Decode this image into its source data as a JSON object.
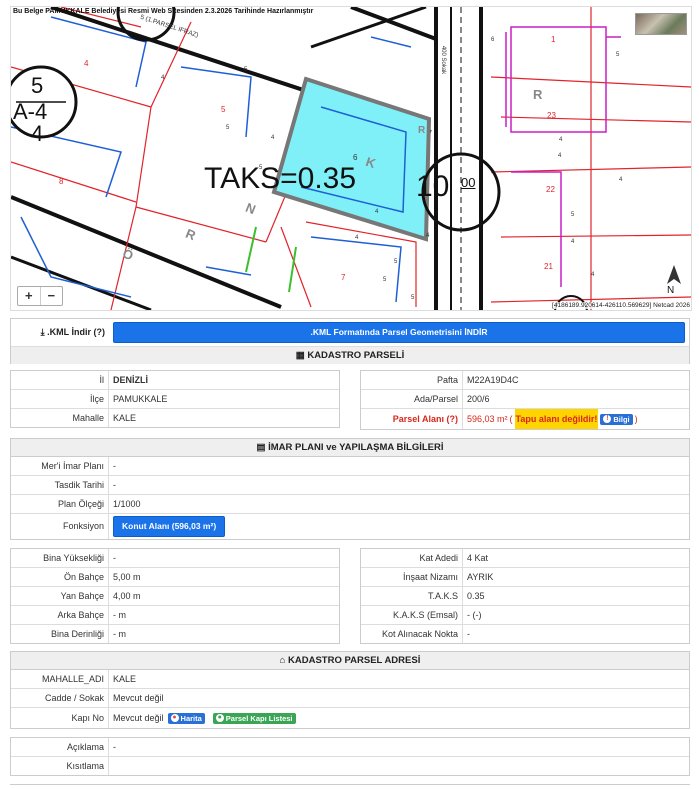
{
  "map": {
    "note": "Bu Belge PAMUKKALE Belediyesi Resmi Web Sitesinden 2.3.2026 Tarihinde Hazırlanmıştır",
    "taks_label": "TAKS=0.35",
    "plan_code_top": "5",
    "plan_code_mid": "A-4",
    "plan_code_bot": "4",
    "road_right_num": "10",
    "road_right_sub": "00",
    "street_label": "400 Sokak",
    "road_label_top": "5 (1.PARSEL IFRAZ)",
    "parcels": [
      "4",
      "5",
      "6",
      "7",
      "8",
      "1",
      "23",
      "22",
      "21"
    ],
    "letters": [
      "K",
      "N",
      "R",
      "Ö",
      "R",
      "R"
    ],
    "zoom_in": "+",
    "zoom_out": "−",
    "north": "N",
    "coords": "[4186189.920614-426110.569629] Netcad 2026",
    "small_nums": [
      "5",
      "4",
      "5",
      "4",
      "5",
      "4",
      "4",
      "5",
      "4",
      "5",
      "6",
      "4",
      "4",
      "5",
      "4",
      "4",
      "5",
      "4",
      "5"
    ]
  },
  "kml": {
    "label": ".KML İndir",
    "help": "(?)",
    "button": ".KML Formatında Parsel Geometrisini İNDİR"
  },
  "kadastro": {
    "title": "KADASTRO PARSELİ",
    "left": [
      {
        "label": "İl",
        "value": "DENİZLİ"
      },
      {
        "label": "İlçe",
        "value": "PAMUKKALE"
      },
      {
        "label": "Mahalle",
        "value": "KALE"
      }
    ],
    "right": [
      {
        "label": "Pafta",
        "value": "M22A19D4C"
      },
      {
        "label": "Ada/Parsel",
        "value": "200/6"
      }
    ],
    "parsel_alani_label": "Parsel Alanı",
    "parsel_alani_help": "(?)",
    "parsel_alani_value": "596,03 m²",
    "parsel_alani_warn": "Tapu alanı değildir!",
    "bilgi": "Bilgi"
  },
  "imar": {
    "title": "İMAR PLANI ve YAPILAŞMA BİLGİLERİ",
    "rows": [
      {
        "label": "Mer'i İmar Planı",
        "value": "-"
      },
      {
        "label": "Tasdik Tarihi",
        "value": "-"
      },
      {
        "label": "Plan Ölçeği",
        "value": "1/1000"
      }
    ],
    "fonksiyon_label": "Fonksiyon",
    "fonksiyon_button": "Konut Alanı (596,03 m²)"
  },
  "yapi": {
    "left": [
      {
        "label": "Bina Yüksekliği",
        "value": "-"
      },
      {
        "label": "Ön Bahçe",
        "value": "5,00 m"
      },
      {
        "label": "Yan Bahçe",
        "value": "4,00 m"
      },
      {
        "label": "Arka Bahçe",
        "value": "- m"
      },
      {
        "label": "Bina Derinliği",
        "value": "- m"
      }
    ],
    "right": [
      {
        "label": "Kat Adedi",
        "value": "4 Kat"
      },
      {
        "label": "İnşaat Nizamı",
        "value": "AYRIK"
      },
      {
        "label": "T.A.K.S",
        "value": "0.35"
      },
      {
        "label": "K.A.K.S (Emsal)",
        "value": "- (-)"
      },
      {
        "label": "Kot Alınacak Nokta",
        "value": "-"
      }
    ]
  },
  "adres": {
    "title": "KADASTRO PARSEL ADRESİ",
    "rows": [
      {
        "label": "MAHALLE_ADI",
        "value": "KALE"
      },
      {
        "label": "Cadde / Sokak",
        "value": "Mevcut değil"
      }
    ],
    "kapi_label": "Kapı No",
    "kapi_value": "Mevcut değil",
    "harita": "Harita",
    "kapi_listesi": "Parsel Kapı Listesi"
  },
  "notlar": {
    "rows": [
      {
        "label": "Açıklama",
        "value": "-"
      },
      {
        "label": "Kısıtlama",
        "value": ""
      }
    ]
  },
  "colors": {
    "parcel_fill": "#80f0f8",
    "blue_lines": "#1f5fd6",
    "red_lines": "#e0242a",
    "magenta_lines": "#c81ec8",
    "button_blue": "#1a73e8"
  }
}
